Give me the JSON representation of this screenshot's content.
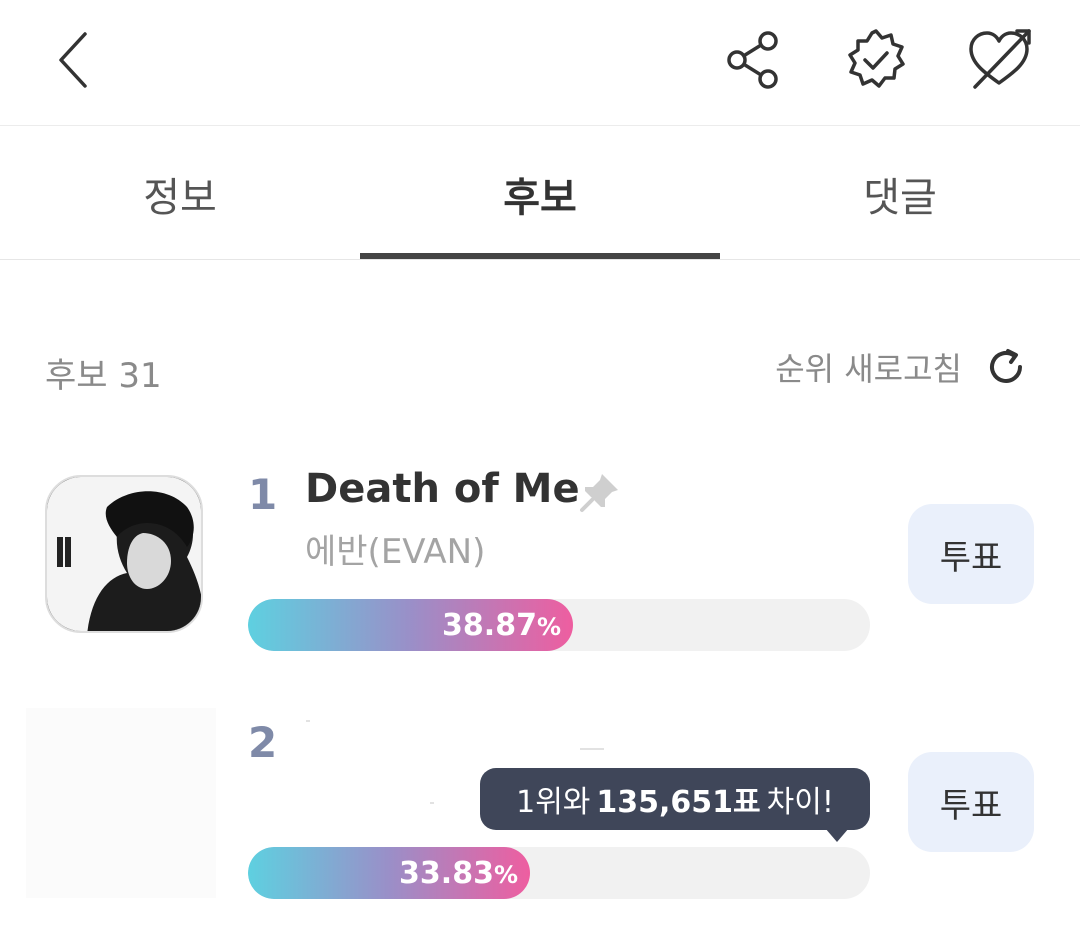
{
  "icons": {
    "back": "chevron-left-icon",
    "share": "share-icon",
    "verified": "verified-badge-icon",
    "cupid": "heart-arrow-icon",
    "refresh": "refresh-icon",
    "pin": "pin-icon"
  },
  "tabs": [
    {
      "label": "정보",
      "active": false
    },
    {
      "label": "후보",
      "active": true
    },
    {
      "label": "댓글",
      "active": false
    }
  ],
  "list_header": {
    "count_label": "후보 31",
    "refresh_label": "순위 새로고침"
  },
  "candidates": [
    {
      "rank": "1",
      "title": "Death of Me",
      "artist": "에반(EVAN)",
      "percent": 38.87,
      "percent_value": "38.87",
      "percent_unit": "%",
      "vote_label": "투표"
    },
    {
      "rank": "2",
      "percent": 33.83,
      "percent_value": "33.83",
      "percent_unit": "%",
      "vote_label": "투표",
      "gap_tooltip": {
        "prefix": "1위와",
        "amount": "135,651표",
        "suffix": "차이!"
      }
    }
  ],
  "colors": {
    "bar_gradient_start": "#5ed0e0",
    "bar_gradient_mid": "#9a8fc8",
    "bar_gradient_end": "#ee5ea0",
    "vote_button_bg": "#eaf0fb",
    "tooltip_bg": "#3f4659",
    "rank_color": "#7f8aa8",
    "active_tab_underline": "#444444"
  }
}
